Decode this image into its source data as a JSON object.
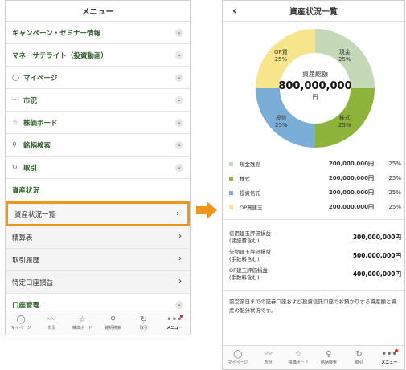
{
  "left": {
    "header_title": "メニュー",
    "rows": [
      {
        "label": "キャンペーン・セミナー情報",
        "icon": "",
        "kind": "expand"
      },
      {
        "label": "マネーサテライト（投資動画）",
        "icon": "",
        "kind": "expand"
      },
      {
        "label": "マイページ",
        "icon": "person-icon",
        "kind": "expand"
      },
      {
        "label": "市況",
        "icon": "line-chart-icon",
        "kind": "expand"
      },
      {
        "label": "株価ボード",
        "icon": "star-icon",
        "kind": "expand"
      },
      {
        "label": "銘柄検索",
        "icon": "search-icon",
        "kind": "expand"
      },
      {
        "label": "取引",
        "icon": "refresh-icon",
        "kind": "expand"
      }
    ],
    "section_label": "資産状況",
    "sub_rows": [
      {
        "label": "資産状況一覧",
        "highlight": true
      },
      {
        "label": "精算表",
        "highlight": false
      },
      {
        "label": "取引履歴",
        "highlight": false
      },
      {
        "label": "特定口座損益",
        "highlight": false
      }
    ],
    "last_row": "口座管理"
  },
  "tabbar": [
    {
      "label": "マイページ",
      "icon": "person-icon"
    },
    {
      "label": "市況",
      "icon": "line-chart-icon"
    },
    {
      "label": "株価ボード",
      "icon": "star-icon"
    },
    {
      "label": "銘柄検索",
      "icon": "search-icon"
    },
    {
      "label": "取引",
      "icon": "refresh-icon"
    },
    {
      "label": "メニュー",
      "icon": "more-icon",
      "active": true
    }
  ],
  "right": {
    "header_title": "資産状況一覧",
    "total_label": "資産総額",
    "total_value": "800,000,000",
    "total_unit": "円",
    "slices": [
      {
        "name": "現金",
        "pct": "25%",
        "value": 25,
        "color": "#c5d8b8"
      },
      {
        "name": "株式",
        "pct": "25%",
        "value": 25,
        "color": "#8db33a"
      },
      {
        "name": "投信",
        "pct": "25%",
        "value": 25,
        "color": "#7aaed6"
      },
      {
        "name": "OP買",
        "pct": "25%",
        "value": 25,
        "color": "#f6e58a"
      }
    ],
    "legend": [
      {
        "name": "現金残高",
        "amount": "200,000,000円",
        "pct": "25%",
        "color": "#c5d8b8"
      },
      {
        "name": "株式",
        "amount": "200,000,000円",
        "pct": "25%",
        "color": "#8db33a"
      },
      {
        "name": "投資信託",
        "amount": "200,000,000円",
        "pct": "25%",
        "color": "#7aaed6"
      },
      {
        "name": "OP買建玉",
        "amount": "200,000,000円",
        "pct": "25%",
        "color": "#f6e58a"
      }
    ],
    "valuations": [
      {
        "label_line1": "信用建玉評価損益",
        "label_line2": "(諸経費含む)",
        "value": "300,000,000円"
      },
      {
        "label_line1": "先物建玉評価損益",
        "label_line2": "(手数料含む)",
        "value": "500,000,000円"
      },
      {
        "label_line1": "OP建玉評価損益",
        "label_line2": "(手数料含む)",
        "value": "400,000,000円"
      }
    ],
    "note": "前営業日までの証券口座および投資信託口座でお預かりする資産額と資産の配分状況です。"
  }
}
